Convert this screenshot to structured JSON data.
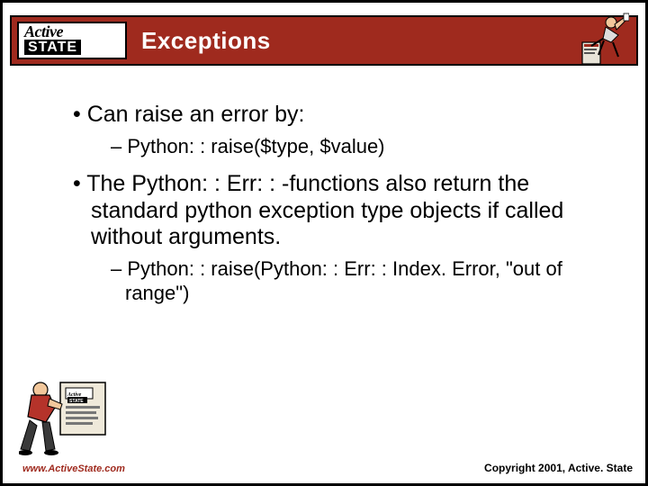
{
  "logo": {
    "top": "Active",
    "bottom": "STATE"
  },
  "title": "Exceptions",
  "bullets": [
    {
      "text": "Can raise an error by:",
      "sub": [
        "Python: : raise($type, $value)"
      ]
    },
    {
      "text": "The Python: : Err: : -functions also return the standard python exception type objects if called without arguments.",
      "sub": [
        "Python: : raise(Python: : Err: : Index. Error, \"out of range\")"
      ]
    }
  ],
  "footer": {
    "url": "www.ActiveState.com",
    "copyright": "Copyright 2001, Active. State"
  }
}
